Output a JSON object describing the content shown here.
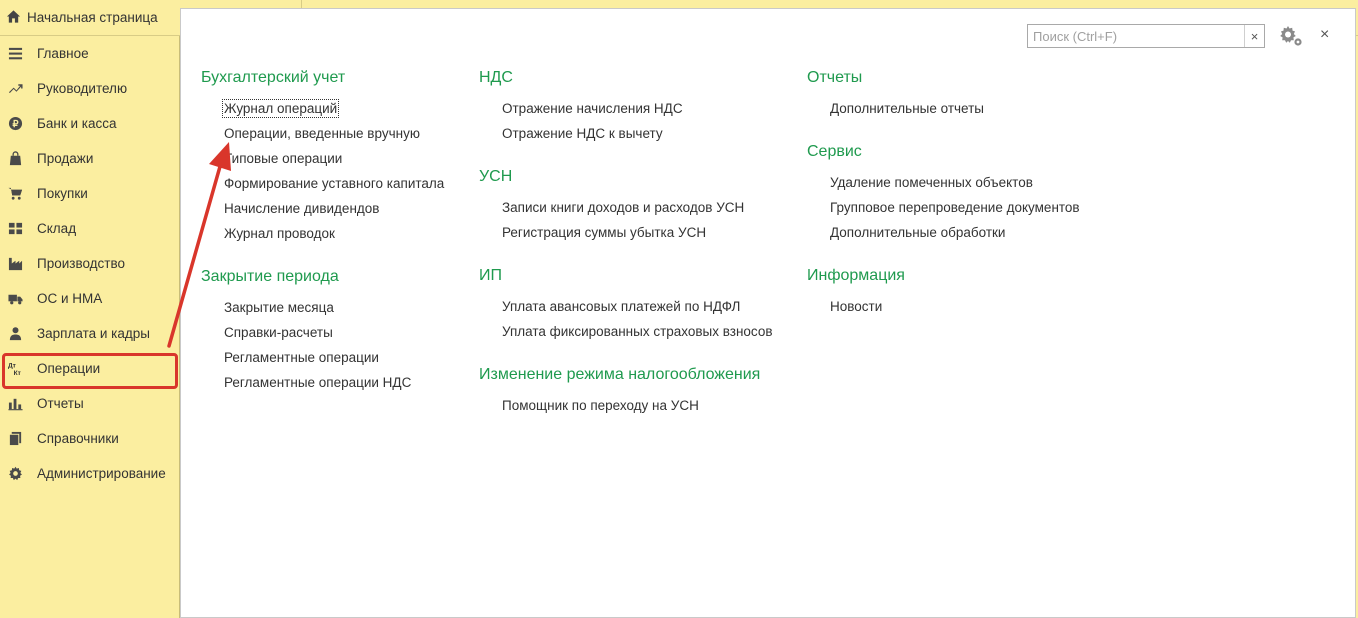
{
  "home_tab": {
    "label": "Начальная страница"
  },
  "sidebar": {
    "items": [
      {
        "label": "Главное",
        "icon": "menu-lines-icon"
      },
      {
        "label": "Руководителю",
        "icon": "trend-icon"
      },
      {
        "label": "Банк и касса",
        "icon": "ruble-coin-icon"
      },
      {
        "label": "Продажи",
        "icon": "shopping-bag-icon"
      },
      {
        "label": "Покупки",
        "icon": "cart-icon"
      },
      {
        "label": "Склад",
        "icon": "warehouse-grid-icon"
      },
      {
        "label": "Производство",
        "icon": "factory-icon"
      },
      {
        "label": "ОС и НМА",
        "icon": "truck-icon"
      },
      {
        "label": "Зарплата и кадры",
        "icon": "person-icon"
      },
      {
        "label": "Операции",
        "icon": "dt-kt-icon"
      },
      {
        "label": "Отчеты",
        "icon": "bar-chart-icon"
      },
      {
        "label": "Справочники",
        "icon": "books-icon"
      },
      {
        "label": "Администрирование",
        "icon": "gear-icon"
      }
    ]
  },
  "search": {
    "placeholder": "Поиск (Ctrl+F)",
    "clear": "×"
  },
  "close_label": "×",
  "columns": {
    "c1": {
      "s1": {
        "title": "Бухгалтерский учет",
        "links": [
          "Журнал операций",
          "Операции, введенные вручную",
          "Типовые операции",
          "Формирование уставного капитала",
          "Начисление дивидендов",
          "Журнал проводок"
        ]
      },
      "s2": {
        "title": "Закрытие периода",
        "links": [
          "Закрытие месяца",
          "Справки-расчеты",
          "Регламентные операции",
          "Регламентные операции НДС"
        ]
      }
    },
    "c2": {
      "s1": {
        "title": "НДС",
        "links": [
          "Отражение начисления НДС",
          "Отражение НДС к вычету"
        ]
      },
      "s2": {
        "title": "УСН",
        "links": [
          "Записи книги доходов и расходов УСН",
          "Регистрация суммы убытка УСН"
        ]
      },
      "s3": {
        "title": "ИП",
        "links": [
          "Уплата авансовых платежей по НДФЛ",
          "Уплата фиксированных страховых взносов"
        ]
      },
      "s4": {
        "title": "Изменение режима налогообложения",
        "links": [
          "Помощник по переходу на УСН"
        ]
      }
    },
    "c3": {
      "s1": {
        "title": "Отчеты",
        "links": [
          "Дополнительные отчеты"
        ]
      },
      "s2": {
        "title": "Сервис",
        "links": [
          "Удаление помеченных объектов",
          "Групповое перепроведение документов",
          "Дополнительные обработки"
        ]
      },
      "s3": {
        "title": "Информация",
        "links": [
          "Новости"
        ]
      }
    }
  },
  "colors": {
    "sidebar_bg": "#fbeea0",
    "section_title": "#1f9a4e",
    "highlight": "#d9362b"
  }
}
